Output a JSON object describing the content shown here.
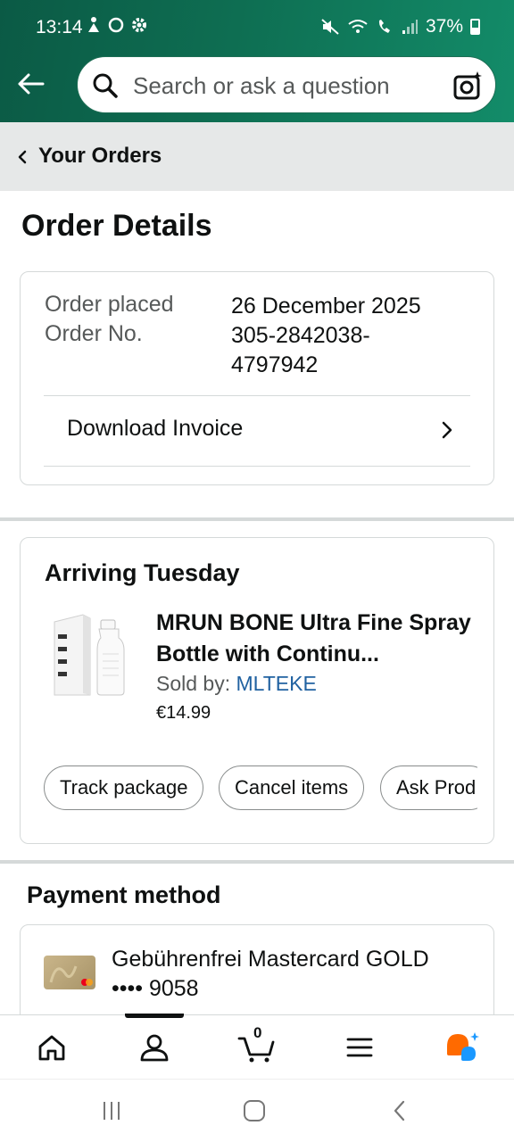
{
  "status_bar": {
    "time": "13:14",
    "battery": "37%"
  },
  "header": {
    "search_placeholder": "Search or ask a question"
  },
  "breadcrumb": {
    "label": "Your Orders"
  },
  "page_title": "Order Details",
  "order": {
    "placed_label": "Order placed",
    "placed_value": "26 December 2025",
    "number_label": "Order No.",
    "number_line1": "305-2842038-",
    "number_line2": "4797942",
    "invoice_label": "Download Invoice"
  },
  "shipment": {
    "heading": "Arriving Tuesday",
    "product_title": "MRUN BONE Ultra Fine Spray Bottle with Continu...",
    "sold_by_label": "Sold by: ",
    "seller": "MLTEKE",
    "price": "€14.99",
    "actions": [
      "Track package",
      "Cancel items",
      "Ask Prod"
    ]
  },
  "payment": {
    "heading": "Payment method",
    "card_name": "Gebührenfrei Mastercard GOLD",
    "card_number": "•••• 9058"
  },
  "bottom_nav": {
    "cart_count": "0"
  }
}
